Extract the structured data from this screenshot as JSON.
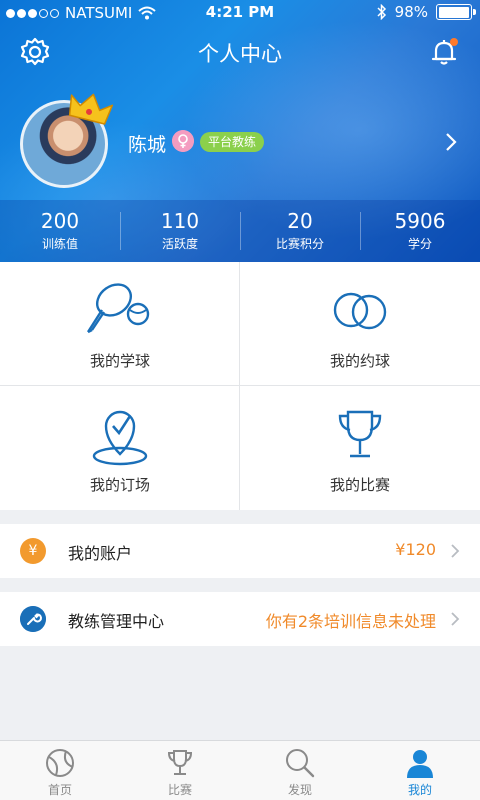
{
  "status_bar": {
    "carrier": "NATSUMI",
    "time": "4:21 PM",
    "battery": "98%",
    "battery_level": 0.98
  },
  "nav": {
    "title": "个人中心"
  },
  "profile": {
    "name": "陈城",
    "role_badge": "平台教练"
  },
  "stats": [
    {
      "value": "200",
      "label": "训练值"
    },
    {
      "value": "110",
      "label": "活跃度"
    },
    {
      "value": "20",
      "label": "比赛积分"
    },
    {
      "value": "5906",
      "label": "学分"
    }
  ],
  "menu_grid": [
    {
      "label": "我的学球",
      "icon": "racket-ball-icon"
    },
    {
      "label": "我的约球",
      "icon": "linked-circles-icon"
    },
    {
      "label": "我的订场",
      "icon": "location-check-icon"
    },
    {
      "label": "我的比赛",
      "icon": "trophy-icon"
    }
  ],
  "list": {
    "account": {
      "icon_text": "¥",
      "title": "我的账户",
      "value": "¥120"
    },
    "coach": {
      "title": "教练管理中心",
      "value": "你有2条培训信息未处理"
    }
  },
  "tabbar": [
    {
      "label": "首页",
      "icon": "ball-icon"
    },
    {
      "label": "比赛",
      "icon": "trophy-icon"
    },
    {
      "label": "发现",
      "icon": "search-icon"
    },
    {
      "label": "我的",
      "icon": "person-icon",
      "active": true
    }
  ],
  "colors": {
    "header_blue": "#1a8ee6",
    "accent_orange": "#f08a2a",
    "icon_blue": "#1a6fb8",
    "badge_green": "#8bd04c",
    "tab_active": "#1a86d6"
  }
}
